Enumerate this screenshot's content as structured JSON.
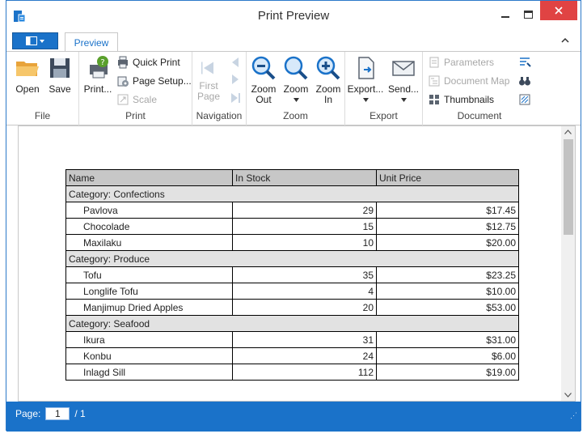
{
  "window": {
    "title": "Print Preview"
  },
  "ribbon_tabs": {
    "active": "Preview"
  },
  "groups": {
    "file": {
      "label": "File",
      "open": "Open",
      "save": "Save"
    },
    "print": {
      "label": "Print",
      "print": "Print...",
      "quick_print": "Quick Print",
      "page_setup": "Page Setup...",
      "scale": "Scale"
    },
    "navigation": {
      "label": "Navigation",
      "first_page_1": "First",
      "first_page_2": "Page"
    },
    "zoom": {
      "label": "Zoom",
      "zoom_out_1": "Zoom",
      "zoom_out_2": "Out",
      "zoom": "Zoom",
      "zoom_in_1": "Zoom",
      "zoom_in_2": "In"
    },
    "export": {
      "label": "Export",
      "export": "Export...",
      "send": "Send..."
    },
    "document": {
      "label": "Document",
      "parameters": "Parameters",
      "document_map": "Document Map",
      "thumbnails": "Thumbnails"
    }
  },
  "report": {
    "headers": [
      "Name",
      "In Stock",
      "Unit Price"
    ],
    "categories": [
      {
        "label": "Category: Confections",
        "rows": [
          [
            "Pavlova",
            "29",
            "$17.45"
          ],
          [
            "Chocolade",
            "15",
            "$12.75"
          ],
          [
            "Maxilaku",
            "10",
            "$20.00"
          ]
        ]
      },
      {
        "label": "Category: Produce",
        "rows": [
          [
            "Tofu",
            "35",
            "$23.25"
          ],
          [
            "Longlife Tofu",
            "4",
            "$10.00"
          ],
          [
            "Manjimup Dried Apples",
            "20",
            "$53.00"
          ]
        ]
      },
      {
        "label": "Category: Seafood",
        "rows": [
          [
            "Ikura",
            "31",
            "$31.00"
          ],
          [
            "Konbu",
            "24",
            "$6.00"
          ],
          [
            "Inlagd Sill",
            "112",
            "$19.00"
          ]
        ]
      }
    ]
  },
  "status": {
    "page_label": "Page:",
    "page_value": "1",
    "page_total": "/ 1"
  }
}
